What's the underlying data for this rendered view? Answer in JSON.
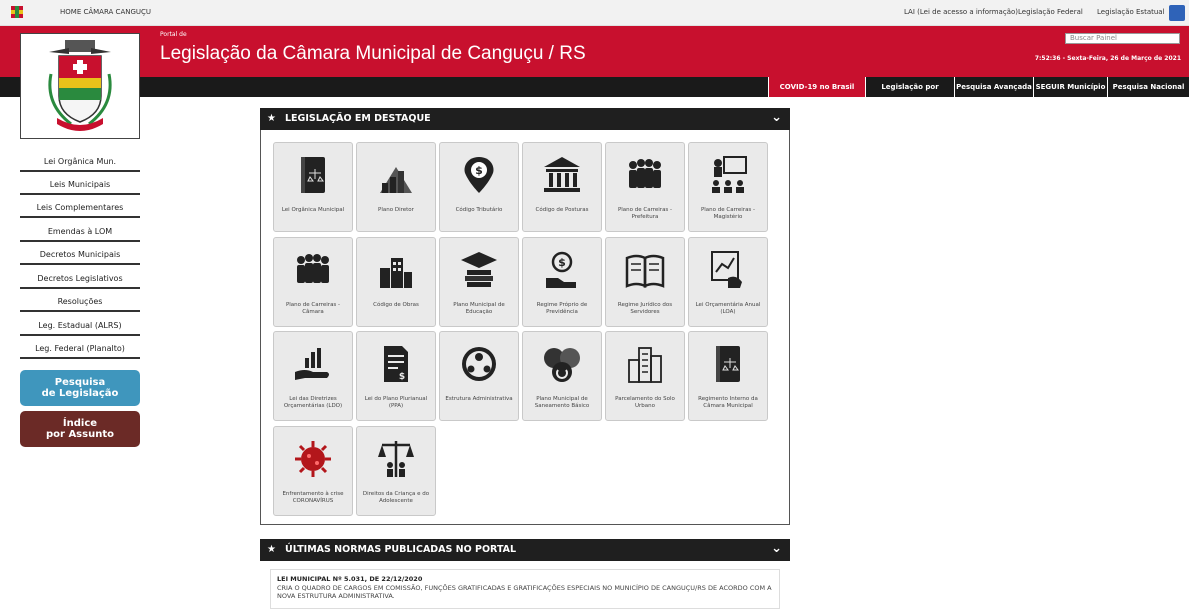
{
  "topbar": {
    "home": "HOME CÂMARA CANGUÇU",
    "links": [
      "LAI (Lei de acesso a informação)",
      "Legislação Federal",
      "Legislação Estatual"
    ]
  },
  "header": {
    "pretitle": "Portal de",
    "title": "Legislação da Câmara Municipal de Canguçu / RS",
    "search_placeholder": "Buscar Painel",
    "datetime": "7:52:36 - Sexta-Feira, 26 de Março de 2021"
  },
  "nav": [
    "COVID-19 no Brasil",
    "Legislação por Assunto",
    "Pesquisa Avançada",
    "SEGUIR Município",
    "Pesquisa Nacional"
  ],
  "sidebar": {
    "items": [
      "Lei Orgânica Mun.",
      "Leis Municipais",
      "Leis Complementares",
      "Emendas à LOM",
      "Decretos Municipais",
      "Decretos Legislativos",
      "Resoluções",
      "Leg. Estadual (ALRS)",
      "Leg. Federal (Planalto)"
    ],
    "btn_pesquisa": "Pesquisa\nde Legislação",
    "btn_indice": "Índice\npor Assunto"
  },
  "destaque": {
    "title": "LEGISLAÇÃO EM DESTAQUE",
    "tiles": [
      {
        "label": "Lei Orgânica Municipal",
        "icon": "law-book-icon"
      },
      {
        "label": "Plano Diretor",
        "icon": "city-plan-icon"
      },
      {
        "label": "Código Tributário",
        "icon": "tax-pin-icon"
      },
      {
        "label": "Código de Posturas",
        "icon": "courthouse-icon"
      },
      {
        "label": "Plano de Carreiras - Prefeitura",
        "icon": "people-group-icon"
      },
      {
        "label": "Plano de Carreiras - Magistério",
        "icon": "teacher-icon"
      },
      {
        "label": "Plano de Carreiras - Câmara",
        "icon": "people-group-icon"
      },
      {
        "label": "Código de Obras",
        "icon": "buildings-icon"
      },
      {
        "label": "Plano Municipal de Educação",
        "icon": "graduation-icon"
      },
      {
        "label": "Regime Próprio de Previdência",
        "icon": "money-hand-icon"
      },
      {
        "label": "Regime Jurídico dos Servidores",
        "icon": "open-book-icon"
      },
      {
        "label": "Lei Orçamentária Anual (LOA)",
        "icon": "chart-hand-icon"
      },
      {
        "label": "Lei das Diretrizes Orçamentárias (LDO)",
        "icon": "growth-hand-icon"
      },
      {
        "label": "Lei do Plano Plurianual (PPA)",
        "icon": "document-money-icon"
      },
      {
        "label": "Estrutura Administrativa",
        "icon": "org-structure-icon"
      },
      {
        "label": "Plano Municipal de Saneamento Básico",
        "icon": "recycle-icon"
      },
      {
        "label": "Parcelamento do Solo Urbano",
        "icon": "urban-buildings-icon"
      },
      {
        "label": "Regimento Interno da Câmara Municipal",
        "icon": "law-book-icon"
      },
      {
        "label": "Enfrentamento à crise CORONAVÍRUS",
        "icon": "virus-icon"
      },
      {
        "label": "Direitos da Criança e do Adolescente",
        "icon": "children-rights-icon"
      }
    ]
  },
  "ultimas": {
    "title": "ÚLTIMAS NORMAS PUBLICADAS NO PORTAL",
    "item_title": "LEI MUNICIPAL Nº 5.031, DE 22/12/2020",
    "item_desc": "CRIA O QUADRO DE CARGOS EM COMISSÃO, FUNÇÕES GRATIFICADAS E GRATIFICAÇÕES ESPECIAIS NO MUNICÍPIO DE CANGUÇU/RS DE ACORDO COM A NOVA ESTRUTURA ADMINISTRATIVA."
  },
  "colors": {
    "brand_red": "#c8102e",
    "dark": "#1a1a1a",
    "btn_blue": "#3f96bd",
    "btn_brown": "#6b2a26"
  }
}
